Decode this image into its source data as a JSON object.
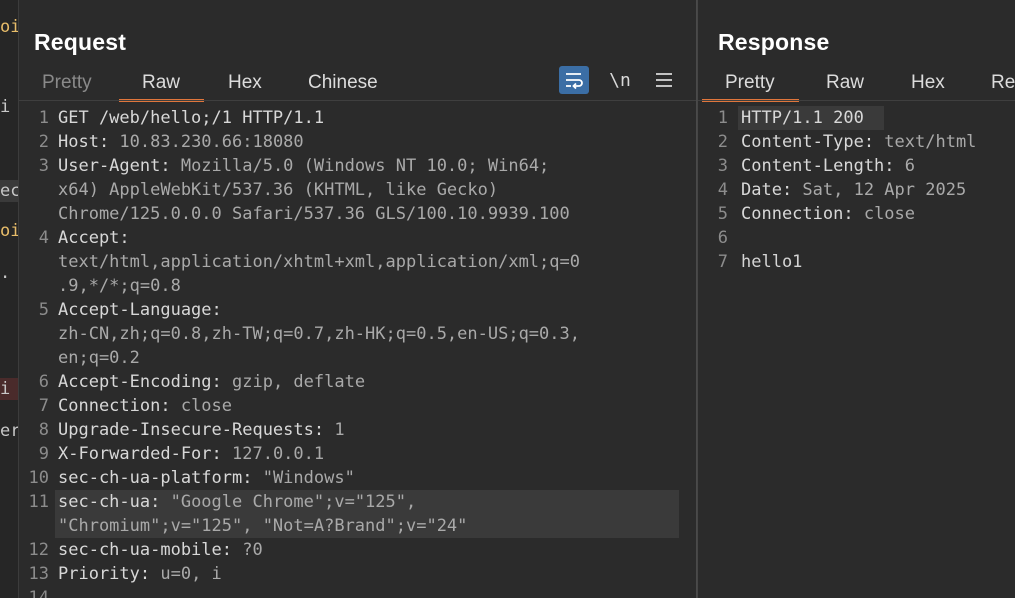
{
  "left_strip": {
    "items": [
      "oi",
      "i",
      "ec",
      "oi",
      ".",
      "i",
      "er"
    ]
  },
  "request": {
    "title": "Request",
    "tabs": [
      "Pretty",
      "Raw",
      "Hex",
      "Chinese"
    ],
    "active_tab": "Raw",
    "tools": {
      "wrap_icon": "wrap-lines-icon",
      "newline_label": "\\n",
      "menu_icon": "hamburger-menu-icon"
    },
    "lines": [
      {
        "n": "1",
        "rows": [
          [
            "GET /web/hello;/1 HTTP/1.1",
            ""
          ]
        ]
      },
      {
        "n": "2",
        "rows": [
          [
            "Host: ",
            "10.83.230.66:18080"
          ]
        ]
      },
      {
        "n": "3",
        "rows": [
          [
            "User-Agent: ",
            "Mozilla/5.0 (Windows NT 10.0; Win64;"
          ],
          [
            "",
            "x64) AppleWebKit/537.36 (KHTML, like Gecko)"
          ],
          [
            "",
            "Chrome/125.0.0.0 Safari/537.36 GLS/100.10.9939.100"
          ]
        ]
      },
      {
        "n": "4",
        "rows": [
          [
            "Accept:",
            ""
          ],
          [
            "",
            "text/html,application/xhtml+xml,application/xml;q=0"
          ],
          [
            "",
            ".9,*/*;q=0.8"
          ]
        ]
      },
      {
        "n": "5",
        "rows": [
          [
            "Accept-Language:",
            ""
          ],
          [
            "",
            "zh-CN,zh;q=0.8,zh-TW;q=0.7,zh-HK;q=0.5,en-US;q=0.3,"
          ],
          [
            "",
            "en;q=0.2"
          ]
        ]
      },
      {
        "n": "6",
        "rows": [
          [
            "Accept-Encoding: ",
            "gzip, deflate"
          ]
        ]
      },
      {
        "n": "7",
        "rows": [
          [
            "Connection: ",
            "close"
          ]
        ]
      },
      {
        "n": "8",
        "rows": [
          [
            "Upgrade-Insecure-Requests: ",
            "1"
          ]
        ]
      },
      {
        "n": "9",
        "rows": [
          [
            "X-Forwarded-For: ",
            "127.0.0.1"
          ]
        ]
      },
      {
        "n": "10",
        "rows": [
          [
            "sec-ch-ua-platform: ",
            "\"Windows\""
          ]
        ]
      },
      {
        "n": "11",
        "rows": [
          [
            "sec-ch-ua: ",
            "\"Google Chrome\";v=\"125\","
          ],
          [
            "",
            "\"Chromium\";v=\"125\", \"Not=A?Brand\";v=\"24\""
          ]
        ]
      },
      {
        "n": "12",
        "rows": [
          [
            "sec-ch-ua-mobile: ",
            "?0"
          ]
        ]
      },
      {
        "n": "13",
        "rows": [
          [
            "Priority: ",
            "u=0, i"
          ]
        ]
      },
      {
        "n": "14",
        "rows": [
          [
            "",
            ""
          ]
        ]
      }
    ]
  },
  "response": {
    "title": "Response",
    "tabs": [
      "Pretty",
      "Raw",
      "Hex",
      "Re"
    ],
    "active_tab": "Pretty",
    "lines": [
      {
        "n": "1",
        "name": "HTTP/1.1 200",
        "value": ""
      },
      {
        "n": "2",
        "name": "Content-Type: ",
        "value": "text/html"
      },
      {
        "n": "3",
        "name": "Content-Length: ",
        "value": "6"
      },
      {
        "n": "4",
        "name": "Date: ",
        "value": "Sat, 12 Apr 2025"
      },
      {
        "n": "5",
        "name": "Connection: ",
        "value": "close"
      },
      {
        "n": "6",
        "name": "",
        "value": ""
      },
      {
        "n": "7",
        "name": "",
        "value": "hello1"
      }
    ]
  },
  "colors": {
    "background": "#2b2b2b",
    "accent_underline": "#e0763c",
    "wrap_button": "#3b6ea5",
    "line_highlight": "#3a3a3a"
  }
}
